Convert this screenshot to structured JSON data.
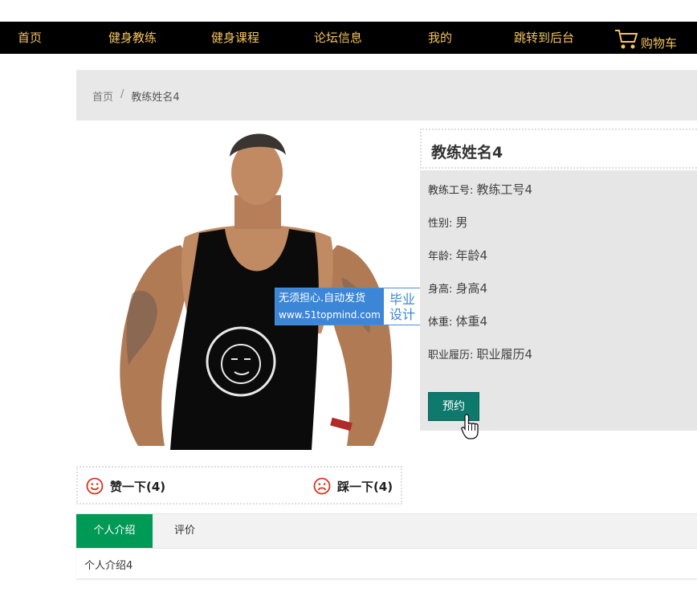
{
  "nav": {
    "items": [
      "首页",
      "健身教练",
      "健身课程",
      "论坛信息",
      "我的",
      "跳转到后台"
    ],
    "cart_label": "购物车"
  },
  "breadcrumb": {
    "home": "首页",
    "separator": "/",
    "current": "教练姓名4"
  },
  "watermark": {
    "line1": "无须担心.自动发货",
    "line2": "www.51topmind.com",
    "badge1": "毕业",
    "badge2": "设计"
  },
  "coach": {
    "name": "教练姓名4",
    "fields": [
      {
        "label": "教练工号:",
        "value": "教练工号4"
      },
      {
        "label": "性别:",
        "value": "男"
      },
      {
        "label": "年龄:",
        "value": "年龄4"
      },
      {
        "label": "身高:",
        "value": "身高4"
      },
      {
        "label": "体重:",
        "value": "体重4"
      },
      {
        "label": "职业履历:",
        "value": "职业履历4"
      }
    ],
    "book_label": "预约"
  },
  "votes": {
    "like": "赞一下(4)",
    "dislike": "踩一下(4)"
  },
  "tabs": {
    "items": [
      "个人介绍",
      "评价"
    ],
    "content": "个人介绍4"
  },
  "colors": {
    "nav_bg": "#000000",
    "nav_text": "#f3c35f",
    "book_btn": "#0e7a6e",
    "tab_active": "#009a57",
    "panel_bg": "#e6e6e6"
  }
}
